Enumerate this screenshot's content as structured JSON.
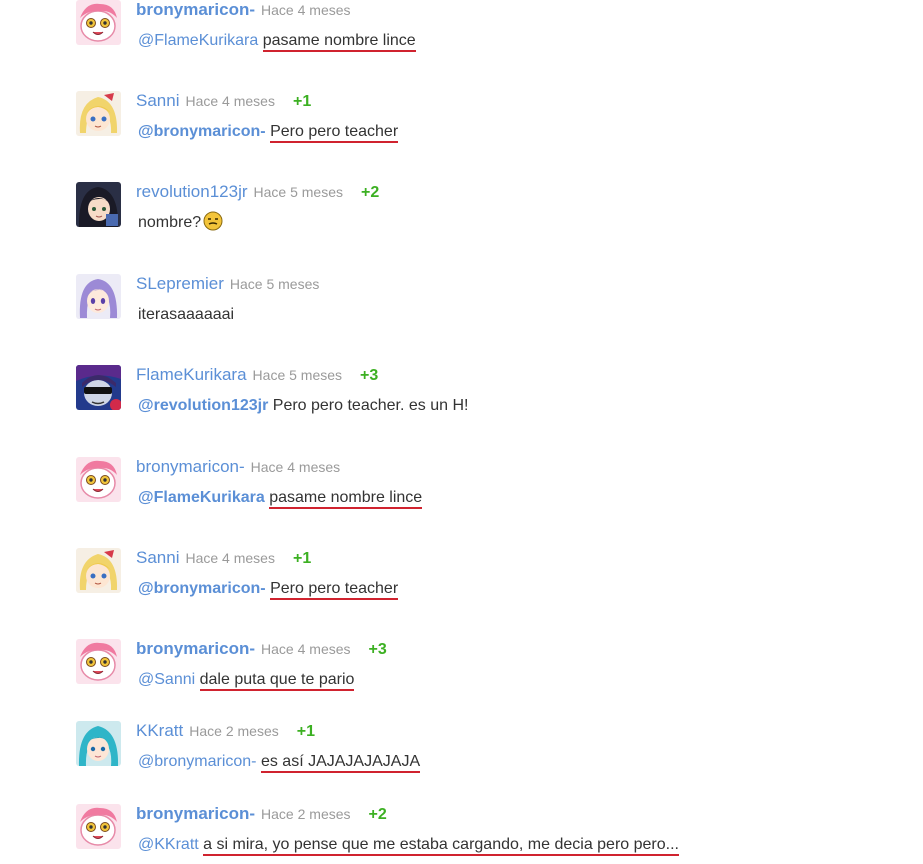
{
  "comments": [
    {
      "avatar": "pink-pony-avatar",
      "user": "bronymaricon-",
      "time": "Hace 4 meses",
      "votes": "",
      "mention": "@FlameKurikara",
      "text": "pasame nombre lince"
    },
    {
      "avatar": "blonde-girl-avatar",
      "user": "Sanni",
      "time": "Hace 4 meses",
      "votes": "+1",
      "mention": "@bronymaricon-",
      "text": "Pero pero teacher"
    },
    {
      "avatar": "dark-hair-girl-avatar",
      "user": "revolution123jr",
      "time": "Hace 5 meses",
      "votes": "+2",
      "mention": "",
      "text": "nombre?",
      "emoji": "meh-face-emoji"
    },
    {
      "avatar": "purple-hair-girl-avatar",
      "user": "SLepremier",
      "time": "Hace 5 meses",
      "votes": "",
      "mention": "",
      "text": "iterasaaaaaai"
    },
    {
      "avatar": "sunglasses-character-avatar",
      "user": "FlameKurikara",
      "time": "Hace 5 meses",
      "votes": "+3",
      "mention": "@revolution123jr",
      "text": "Pero pero teacher. es un H!"
    },
    {
      "avatar": "pink-pony-avatar",
      "user": "bronymaricon-",
      "time": "Hace 4 meses",
      "votes": "",
      "mention": "@FlameKurikara",
      "text": "pasame nombre lince"
    },
    {
      "avatar": "blonde-girl-avatar",
      "user": "Sanni",
      "time": "Hace 4 meses",
      "votes": "+1",
      "mention": "@bronymaricon-",
      "text": "Pero pero teacher"
    },
    {
      "avatar": "pink-pony-avatar",
      "user": "bronymaricon-",
      "time": "Hace 4 meses",
      "votes": "+3",
      "mention": "@Sanni",
      "text": "dale puta que te pario"
    },
    {
      "avatar": "teal-hair-character-avatar",
      "user": "KKratt",
      "time": "Hace 2 meses",
      "votes": "+1",
      "mention": "@bronymaricon-",
      "text": "es así JAJAJAJAJAJA"
    },
    {
      "avatar": "pink-pony-avatar",
      "user": "bronymaricon-",
      "time": "Hace 2 meses",
      "votes": "+2",
      "mention": "@KKratt",
      "text": "a si mira, yo pense que me estaba cargando, me decia pero pero..."
    }
  ],
  "colors": {
    "username": "#5b8fd6",
    "timestamp": "#9a9a9a",
    "votes": "#3cb022",
    "underline": "#d0232f"
  }
}
